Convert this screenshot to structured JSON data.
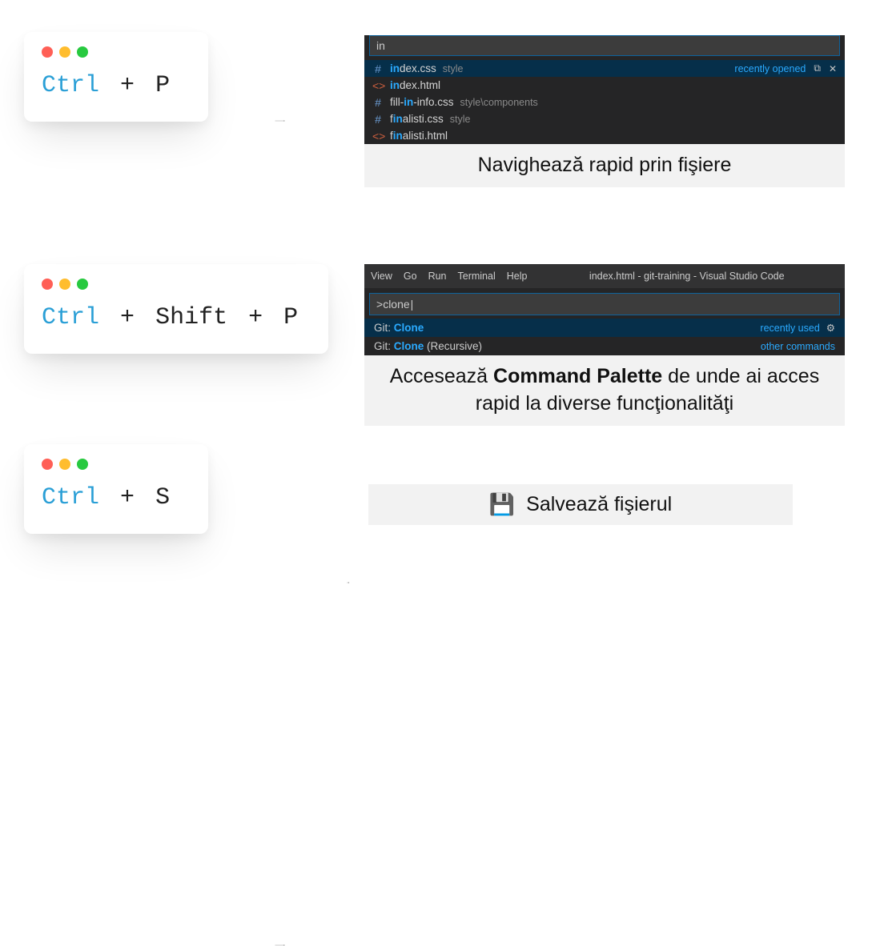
{
  "kbd": {
    "ctrl": "Ctrl",
    "shift": "Shift",
    "plus": "+",
    "p": "P",
    "s": "S"
  },
  "quickopen": {
    "query": "in",
    "recently_opened": "recently opened",
    "items": [
      {
        "icon": "#",
        "iconClass": "qo-css",
        "pre": "",
        "hl": "in",
        "post": "dex.css",
        "path": "style"
      },
      {
        "icon": "<>",
        "iconClass": "qo-html",
        "pre": "",
        "hl": "in",
        "post": "dex.html",
        "path": ""
      },
      {
        "icon": "#",
        "iconClass": "qo-css",
        "pre": "fill-",
        "hl": "in",
        "post": "-info.css",
        "path": "style\\components"
      },
      {
        "icon": "#",
        "iconClass": "qo-css",
        "pre": "f",
        "hl": "in",
        "post": "alisti.css",
        "path": "style"
      },
      {
        "icon": "<>",
        "iconClass": "qo-html",
        "pre": "f",
        "hl": "in",
        "post": "alisti.html",
        "path": ""
      }
    ],
    "caption": "Navighează rapid prin fişiere"
  },
  "palette": {
    "menu": [
      "View",
      "Go",
      "Run",
      "Terminal",
      "Help"
    ],
    "title": "index.html - git-training - Visual Studio Code",
    "query_prefix": ">",
    "query": "clone",
    "recently_used": "recently used",
    "other_commands": "other commands",
    "items": [
      {
        "prefix": "Git: ",
        "hl": "Clone",
        "suffix": "",
        "right": "recently_used",
        "gear": true
      },
      {
        "prefix": "Git: ",
        "hl": "Clone",
        "suffix": " (Recursive)",
        "right": "other_commands",
        "gear": false
      }
    ],
    "caption_pre": "Accesează ",
    "caption_bold": "Command Palette",
    "caption_post": " de unde ai acces rapid la diverse funcţionalităţi"
  },
  "save": {
    "caption": "Salvează fişierul"
  }
}
